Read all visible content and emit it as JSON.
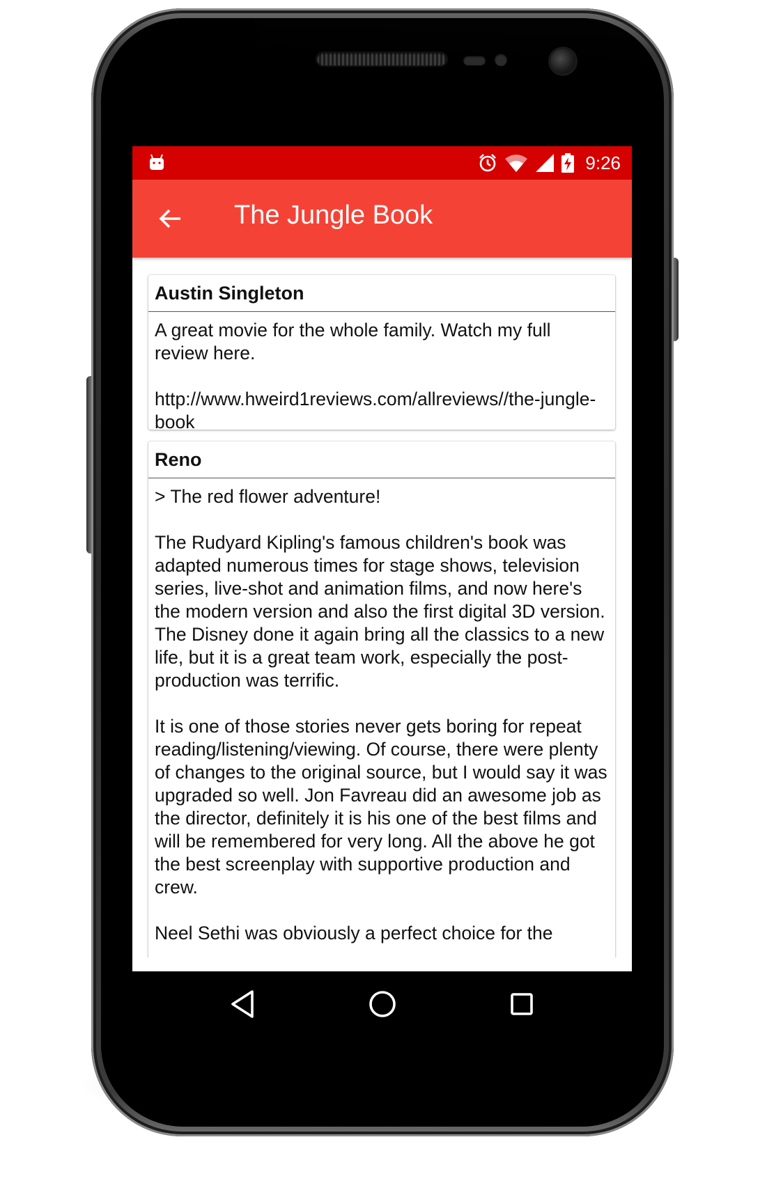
{
  "status_bar": {
    "time": "9:26",
    "icons": [
      "android-debug-icon",
      "alarm-icon",
      "wifi-icon",
      "cell-signal-icon",
      "battery-charging-icon"
    ],
    "background_color": "#d50000"
  },
  "app_bar": {
    "title": "The Jungle Book",
    "back_icon": "arrow-back-icon",
    "background_color": "#f44336"
  },
  "reviews": [
    {
      "author": "Austin Singleton",
      "paragraphs": [
        "A great movie for the whole family. Watch my full review here.",
        "http://www.hweird1reviews.com/allreviews//the-jungle-book"
      ]
    },
    {
      "author": "Reno",
      "paragraphs": [
        "> The red flower adventure!",
        "The Rudyard Kipling's famous children's book was adapted numerous times for stage shows, television series, live-shot and animation films, and now here's the modern version and also the first digital 3D version. The Disney done it again bring all the classics to a new life, but it is a great team work, especially the post-production was terrific.",
        "It is one of those stories never gets boring for repeat reading/listening/viewing. Of course, there were plenty of changes to the original source, but I would say it was upgraded so well. Jon Favreau did an awesome job as the director, definitely it is his one of the best films and will be remembered for very long. All the above he got the best screenplay with supportive production and crew.",
        "Neel Sethi was obviously a perfect choice for the"
      ]
    }
  ],
  "nav_bar": {
    "buttons": [
      "back-triangle-icon",
      "home-circle-icon",
      "recents-square-icon"
    ]
  }
}
